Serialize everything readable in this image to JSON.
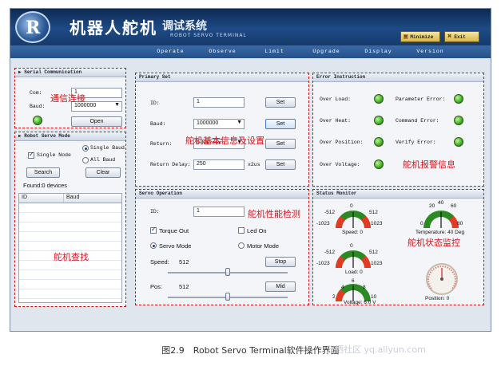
{
  "header": {
    "title": "机器人舵机",
    "subtitle": "调试系统",
    "subtitle_en": "ROBOT SERVO TERMINAL",
    "logo_letter": "R",
    "minimize_label": "Minimize",
    "exit_label": "Exit"
  },
  "menu": [
    "Operate",
    "Observe",
    "Limit",
    "Upgrade",
    "Display",
    "Version"
  ],
  "serial": {
    "title": "Serial Communication",
    "com_label": "Com:",
    "com_value": "1",
    "baud_label": "Baud:",
    "baud_value": "1000000",
    "open_label": "Open",
    "annotation": "通信连接"
  },
  "servo_mode": {
    "title": "Robot Servo Mode",
    "single_baud": "Single Baud",
    "single_node": "Single Node",
    "all_baud": "All Baud",
    "search_label": "Search",
    "clear_label": "Clear",
    "found_text": "Found:0 devices",
    "col_id": "ID",
    "col_baud": "Baud",
    "annotation": "舵机查找"
  },
  "primary": {
    "title": "Primary Set",
    "id_label": "ID:",
    "id_value": "1",
    "baud_label": "Baud:",
    "baud_value": "1000000",
    "return_label": "Return:",
    "return_value": "0-No return",
    "delay_label": "Return Delay:",
    "delay_value": "250",
    "delay_unit": "x2us",
    "set_label": "Set",
    "annotation": "舵机基本信息及设置"
  },
  "error": {
    "title": "Error Instruction",
    "over_load": "Over Load:",
    "param_error": "Parameter Error:",
    "over_heat": "Over Heat:",
    "cmd_error": "Command Error:",
    "over_position": "Over Position:",
    "verify_error": "Verify Error:",
    "over_voltage": "Over Voltage:",
    "annotation": "舵机报警信息"
  },
  "operation": {
    "title": "Servo Operation",
    "id_label": "ID:",
    "id_value": "1",
    "torque_label": "Torque Out",
    "led_label": "Led On",
    "servo_mode": "Servo Mode",
    "motor_mode": "Motor Mode",
    "speed_label": "Speed:",
    "speed_value": "512",
    "stop_label": "Stop",
    "pos_label": "Pos:",
    "pos_value": "512",
    "mid_label": "Mid",
    "annotation": "舵机性能检测",
    "speed_fraction": 0.5,
    "pos_fraction": 0.5
  },
  "status": {
    "title": "Status Monitor",
    "annotation": "舵机状态监控",
    "speed": {
      "left": "-512",
      "right": "512",
      "top": "0",
      "ll": "-1023",
      "lr": "1023",
      "label": "Speed: 0"
    },
    "temp": {
      "t1": "20",
      "t2": "40",
      "t3": "60",
      "l": "0",
      "r": "80",
      "label": "Temperature: 40 Deg"
    },
    "load": {
      "left": "-512",
      "right": "512",
      "top": "0",
      "ll": "-1023",
      "lr": "1023",
      "label": "Load: 0"
    },
    "voltage": {
      "t1": "4",
      "t2": "6",
      "t3": "8",
      "l": "2",
      "r": "10",
      "label": "Voltage: 6.0 V"
    },
    "position_label": "Position: 0"
  },
  "caption": "图2.9　Robot Servo Terminal软件操作界面",
  "watermark": "云栖社区 yq.aliyun.com"
}
